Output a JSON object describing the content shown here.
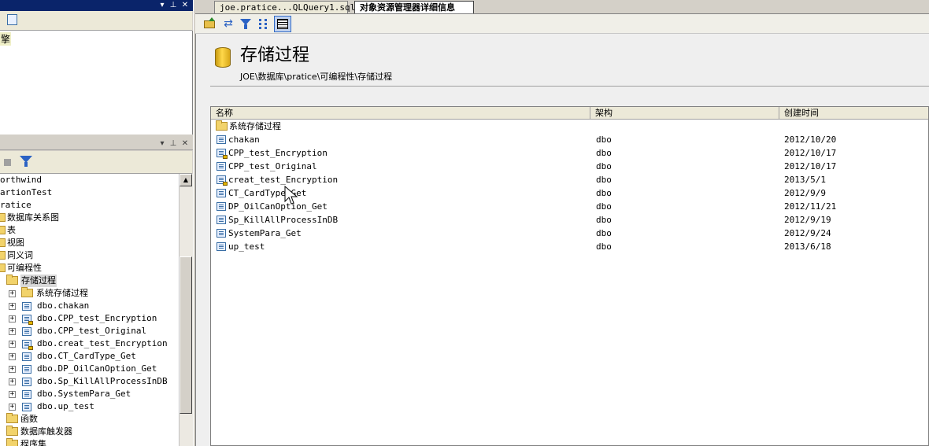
{
  "left_top_pane": {
    "partial_text": "擎"
  },
  "left_tree_pane": {
    "tree_items": [
      {
        "label": "orthwind",
        "level": "db"
      },
      {
        "label": "artionTest",
        "level": "db"
      },
      {
        "label": "ratice",
        "level": "db"
      }
    ],
    "folders_level1": [
      {
        "label": "数据库关系图"
      },
      {
        "label": "表"
      },
      {
        "label": "视图"
      },
      {
        "label": "同义词"
      },
      {
        "label": "可编程性"
      }
    ],
    "stored_proc_folder": "存储过程",
    "system_sp_folder": "系统存储过程",
    "procedures": [
      {
        "label": "dbo.chakan",
        "locked": false
      },
      {
        "label": "dbo.CPP_test_Encryption",
        "locked": true
      },
      {
        "label": "dbo.CPP_test_Original",
        "locked": false
      },
      {
        "label": "dbo.creat_test_Encryption",
        "locked": true
      },
      {
        "label": "dbo.CT_CardType_Get",
        "locked": false
      },
      {
        "label": "dbo.DP_OilCanOption_Get",
        "locked": false
      },
      {
        "label": "dbo.Sp_KillAllProcessInDB",
        "locked": false
      },
      {
        "label": "dbo.SystemPara_Get",
        "locked": false
      },
      {
        "label": "dbo.up_test",
        "locked": false
      }
    ],
    "folders_after": [
      {
        "label": "函数"
      },
      {
        "label": "数据库触发器"
      },
      {
        "label": "程序集"
      }
    ]
  },
  "tabs": [
    {
      "label": "joe.pratice...QLQuery1.sql",
      "active": false
    },
    {
      "label": "对象资源管理器详细信息",
      "active": true
    }
  ],
  "header": {
    "title": "存储过程",
    "path": "JOE\\数据库\\pratice\\可编程性\\存储过程"
  },
  "list": {
    "columns": [
      "名称",
      "架构",
      "创建时间"
    ],
    "folder_row": "系统存储过程",
    "rows": [
      {
        "name": "chakan",
        "schema": "dbo",
        "created": "2012/10/20",
        "locked": false
      },
      {
        "name": "CPP_test_Encryption",
        "schema": "dbo",
        "created": "2012/10/17",
        "locked": true
      },
      {
        "name": "CPP_test_Original",
        "schema": "dbo",
        "created": "2012/10/17",
        "locked": false
      },
      {
        "name": "creat_test_Encryption",
        "schema": "dbo",
        "created": "2013/5/1",
        "locked": true
      },
      {
        "name": "CT_CardType_Get",
        "schema": "dbo",
        "created": "2012/9/9",
        "locked": false
      },
      {
        "name": "DP_OilCanOption_Get",
        "schema": "dbo",
        "created": "2012/11/21",
        "locked": false
      },
      {
        "name": "Sp_KillAllProcessInDB",
        "schema": "dbo",
        "created": "2012/9/19",
        "locked": false
      },
      {
        "name": "SystemPara_Get",
        "schema": "dbo",
        "created": "2012/9/24",
        "locked": false
      },
      {
        "name": "up_test",
        "schema": "dbo",
        "created": "2013/6/18",
        "locked": false
      }
    ]
  },
  "colors": {
    "active_title": "#0a246a",
    "chrome": "#d4d0c8",
    "folder": "#f2d36b"
  }
}
